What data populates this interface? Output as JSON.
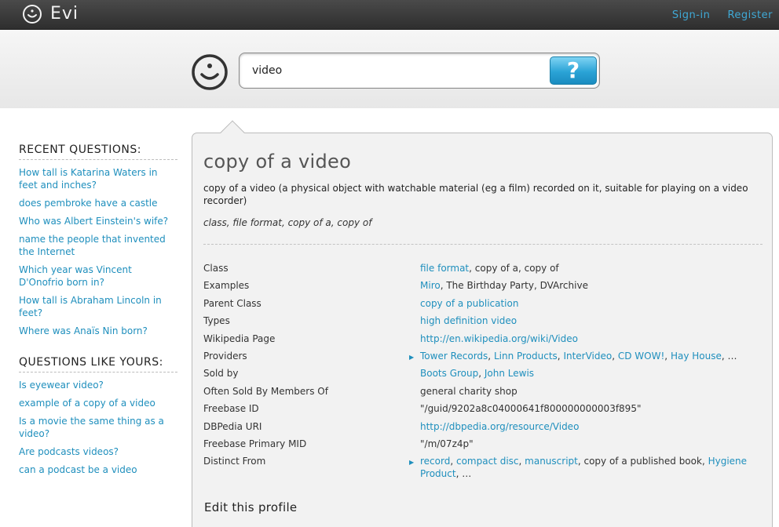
{
  "app": {
    "name": "Evi"
  },
  "top_links": [
    "Sign-in",
    "Register"
  ],
  "search": {
    "value": "video",
    "button_label": "?"
  },
  "sidebar": {
    "recent_heading": "RECENT QUESTIONS:",
    "recent": [
      "How tall is Katarina Waters in feet and inches?",
      "does pembroke have a castle",
      "Who was Albert Einstein's wife?",
      "name the people that invented the Internet",
      "Which year was Vincent D'Onofrio born in?",
      "How tall is Abraham Lincoln in feet?",
      "Where was Anaïs Nin born?"
    ],
    "similar_heading": "QUESTIONS LIKE YOURS:",
    "similar": [
      "Is eyewear video?",
      "example of a copy of a video",
      "Is a movie the same thing as a video?",
      "Are podcasts videos?",
      "can a podcast be a video"
    ]
  },
  "panel": {
    "title": "copy of a video",
    "description": "copy of a video (a physical object with watchable material (eg a film) recorded on it, suitable for playing on a video recorder)",
    "tags": "class, file format, copy of a, copy of",
    "edit_label": "Edit this profile",
    "facts": [
      {
        "label": "Class",
        "value": [
          {
            "t": "file format",
            "link": true
          },
          {
            "t": ", copy of a, copy of"
          }
        ]
      },
      {
        "label": "Examples",
        "value": [
          {
            "t": "Miro",
            "link": true
          },
          {
            "t": ", The Birthday Party, DVArchive"
          }
        ]
      },
      {
        "label": "Parent Class",
        "value": [
          {
            "t": "copy of a publication",
            "link": true
          }
        ]
      },
      {
        "label": "Types",
        "value": [
          {
            "t": "high definition video",
            "link": true
          }
        ]
      },
      {
        "label": "Wikipedia Page",
        "value": [
          {
            "t": "http://en.wikipedia.org/wiki/Video",
            "link": true
          }
        ]
      },
      {
        "label": "Providers",
        "arrow": true,
        "value": [
          {
            "t": "Tower Records",
            "link": true
          },
          {
            "t": ", "
          },
          {
            "t": "Linn Products",
            "link": true
          },
          {
            "t": ", "
          },
          {
            "t": "InterVideo",
            "link": true
          },
          {
            "t": ", "
          },
          {
            "t": "CD WOW!",
            "link": true
          },
          {
            "t": ", "
          },
          {
            "t": "Hay House",
            "link": true
          },
          {
            "t": ", …"
          }
        ]
      },
      {
        "label": "Sold by",
        "value": [
          {
            "t": "Boots Group",
            "link": true
          },
          {
            "t": ", "
          },
          {
            "t": "John Lewis",
            "link": true
          }
        ]
      },
      {
        "label": "Often Sold By Members Of",
        "value": [
          {
            "t": "general charity shop"
          }
        ]
      },
      {
        "label": "Freebase ID",
        "value": [
          {
            "t": "\"/guid/9202a8c04000641f800000000003f895\""
          }
        ]
      },
      {
        "label": "DBPedia URI",
        "value": [
          {
            "t": "http://dbpedia.org/resource/Video",
            "link": true
          }
        ]
      },
      {
        "label": "Freebase Primary MID",
        "value": [
          {
            "t": "\"/m/07z4p\""
          }
        ]
      },
      {
        "label": "Distinct From",
        "arrow": true,
        "wrap": true,
        "value": [
          {
            "t": "record",
            "link": true
          },
          {
            "t": ", "
          },
          {
            "t": "compact disc",
            "link": true
          },
          {
            "t": ", "
          },
          {
            "t": "manuscript",
            "link": true
          },
          {
            "t": ", copy of a published book, "
          },
          {
            "t": "Hygiene Product",
            "link": true
          },
          {
            "t": ", …"
          }
        ]
      }
    ]
  }
}
